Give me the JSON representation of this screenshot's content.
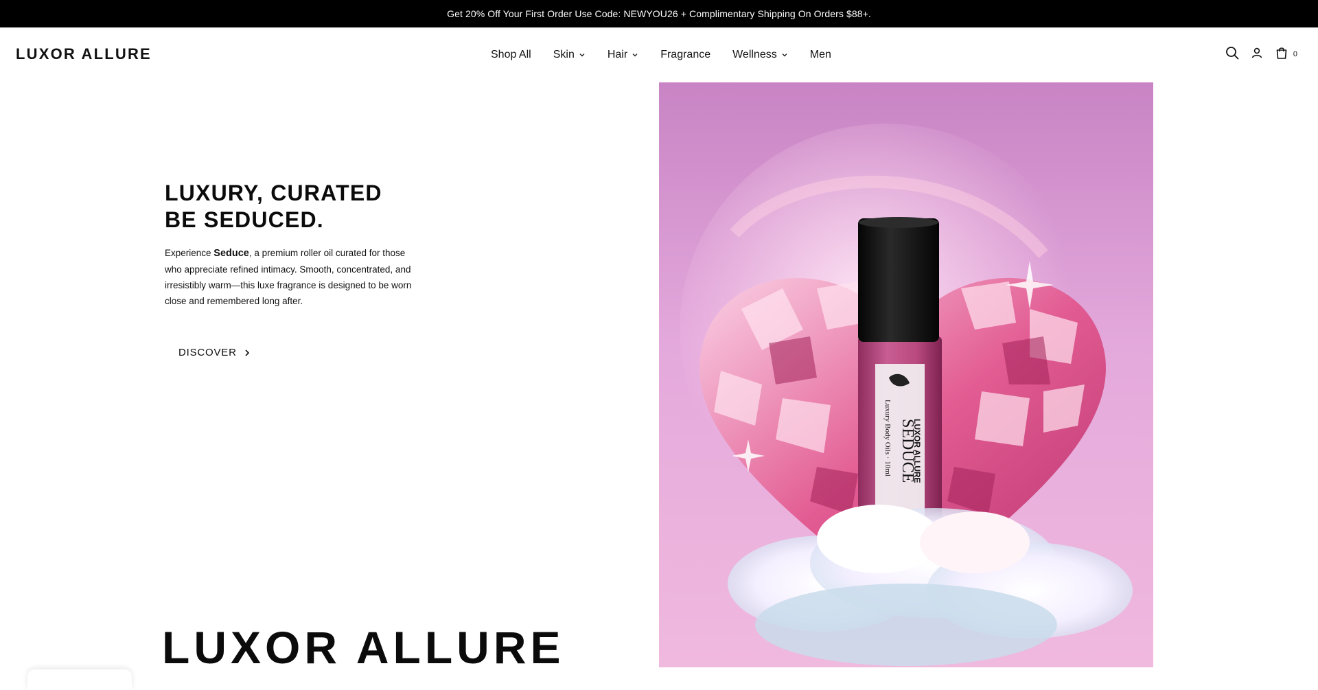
{
  "announcement": {
    "text": "Get 20% Off Your First Order Use Code: NEWYOU26 + Complimentary  Shipping On Orders $88+."
  },
  "header": {
    "logo": "LUXOR ALLURE",
    "nav": [
      {
        "label": "Shop All",
        "has_dropdown": false
      },
      {
        "label": "Skin",
        "has_dropdown": true
      },
      {
        "label": "Hair",
        "has_dropdown": true
      },
      {
        "label": "Fragrance",
        "has_dropdown": false
      },
      {
        "label": "Wellness",
        "has_dropdown": true
      },
      {
        "label": "Men",
        "has_dropdown": false
      }
    ],
    "icons": [
      "search-icon",
      "account-icon",
      "cart-icon"
    ],
    "cart_count": "0"
  },
  "hero": {
    "heading_line1": "LUXURY, CURATED",
    "heading_line2": "BE SEDUCED.",
    "copy_prefix": "Experience ",
    "copy_product": "Seduce",
    "copy_rest": ", a premium roller oil curated for those who appreciate refined intimacy. Smooth, concentrated, and irresistibly warm—this luxe fragrance is designed to be worn close and remembered long after.",
    "cta_label": "DISCOVER"
  },
  "product_label": {
    "brand": "LUXOR ALLURE",
    "name": "SEDUCE",
    "subtitle": "Luxury Body Oils · 10ml"
  },
  "brand_banner": "LUXOR ALLURE",
  "colors": {
    "announcement_bg": "#000000",
    "text": "#111111",
    "hero_pink": "#d87fc8",
    "crystal_pink": "#e2588f",
    "bottle_glass": "#b9497e",
    "cap": "#141414"
  }
}
